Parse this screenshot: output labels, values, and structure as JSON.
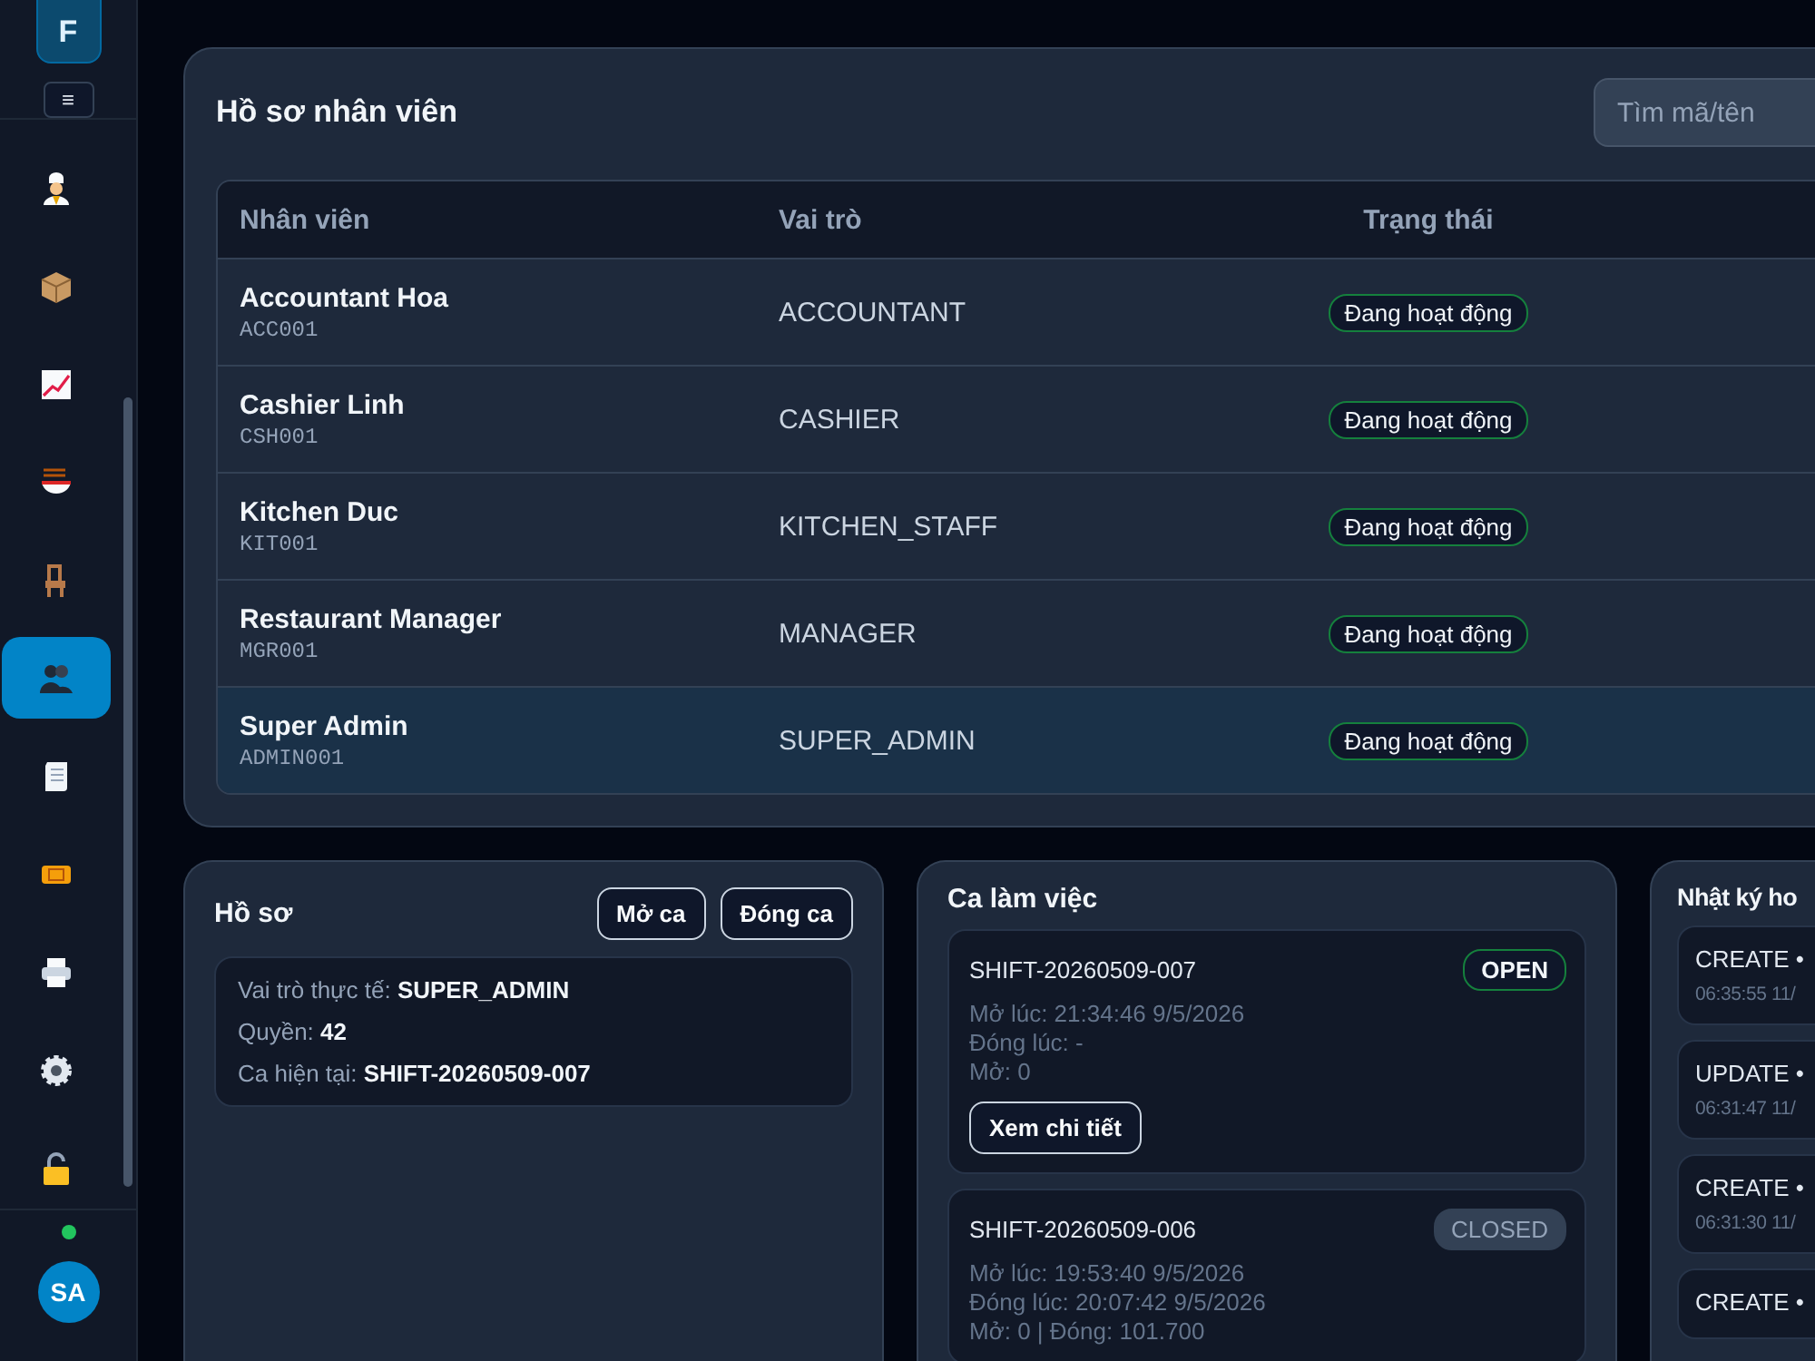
{
  "sidebar": {
    "logo": "F",
    "menu_button": "≡",
    "items": [
      {
        "selected": false
      },
      {
        "selected": false
      },
      {
        "selected": false
      },
      {
        "selected": false
      },
      {
        "selected": false
      },
      {
        "selected": true
      },
      {
        "selected": false
      },
      {
        "selected": false
      },
      {
        "selected": false
      },
      {
        "selected": false
      },
      {
        "selected": false
      }
    ],
    "online": true,
    "avatar": "SA"
  },
  "staff_panel": {
    "title": "Hồ sơ nhân viên",
    "search": {
      "placeholder": "Tìm mã/tên"
    },
    "table": {
      "columns": [
        "Nhân viên",
        "Vai trò",
        "Trạng thái"
      ],
      "rows": [
        {
          "name": "Accountant Hoa",
          "code": "ACC001",
          "role": "ACCOUNTANT",
          "status": "Đang hoạt động",
          "kind": "active",
          "selected": false
        },
        {
          "name": "Cashier Linh",
          "code": "CSH001",
          "role": "CASHIER",
          "status": "Đang hoạt động",
          "kind": "active",
          "selected": false
        },
        {
          "name": "Kitchen Duc",
          "code": "KIT001",
          "role": "KITCHEN_STAFF",
          "status": "Đang hoạt động",
          "kind": "active",
          "selected": false
        },
        {
          "name": "Restaurant Manager",
          "code": "MGR001",
          "role": "MANAGER",
          "status": "Đang hoạt động",
          "kind": "active",
          "selected": false
        },
        {
          "name": "Super Admin",
          "code": "ADMIN001",
          "role": "SUPER_ADMIN",
          "status": "Đang hoạt động",
          "kind": "active",
          "selected": true
        }
      ]
    }
  },
  "profile_panel": {
    "title": "Hồ sơ",
    "buttons": [
      "Mở ca",
      "Đóng ca"
    ],
    "lines": [
      "Vai trò thực tế: **SUPER_ADMIN**",
      "Quyền: **42**",
      "Ca hiện tại: **SHIFT-20260509-007**"
    ]
  },
  "shifts_panel": {
    "title": "Ca làm việc",
    "shifts": [
      {
        "code": "SHIFT-20260509-007",
        "status": "OPEN",
        "kind": "open",
        "lines": [
          "Mở lúc: 21:34:46 9/5/2026",
          "Đóng lúc: -",
          "Mở: 0"
        ],
        "button": "Xem chi tiết"
      },
      {
        "code": "SHIFT-20260509-006",
        "status": "CLOSED",
        "kind": "closed",
        "lines": [
          "Mở lúc: 19:53:40 9/5/2026",
          "Đóng lúc: 20:07:42 9/5/2026",
          "Mở: 0  |  Đóng: 101.700"
        ]
      }
    ]
  },
  "log_panel": {
    "title": "Nhật ký ho",
    "entries": [
      {
        "action": "CREATE •",
        "time": "06:35:55 11/"
      },
      {
        "action": "UPDATE •",
        "time": "06:31:47 11/"
      },
      {
        "action": "CREATE •",
        "time": "06:31:30 11/"
      },
      {
        "action": "CREATE •"
      }
    ]
  }
}
